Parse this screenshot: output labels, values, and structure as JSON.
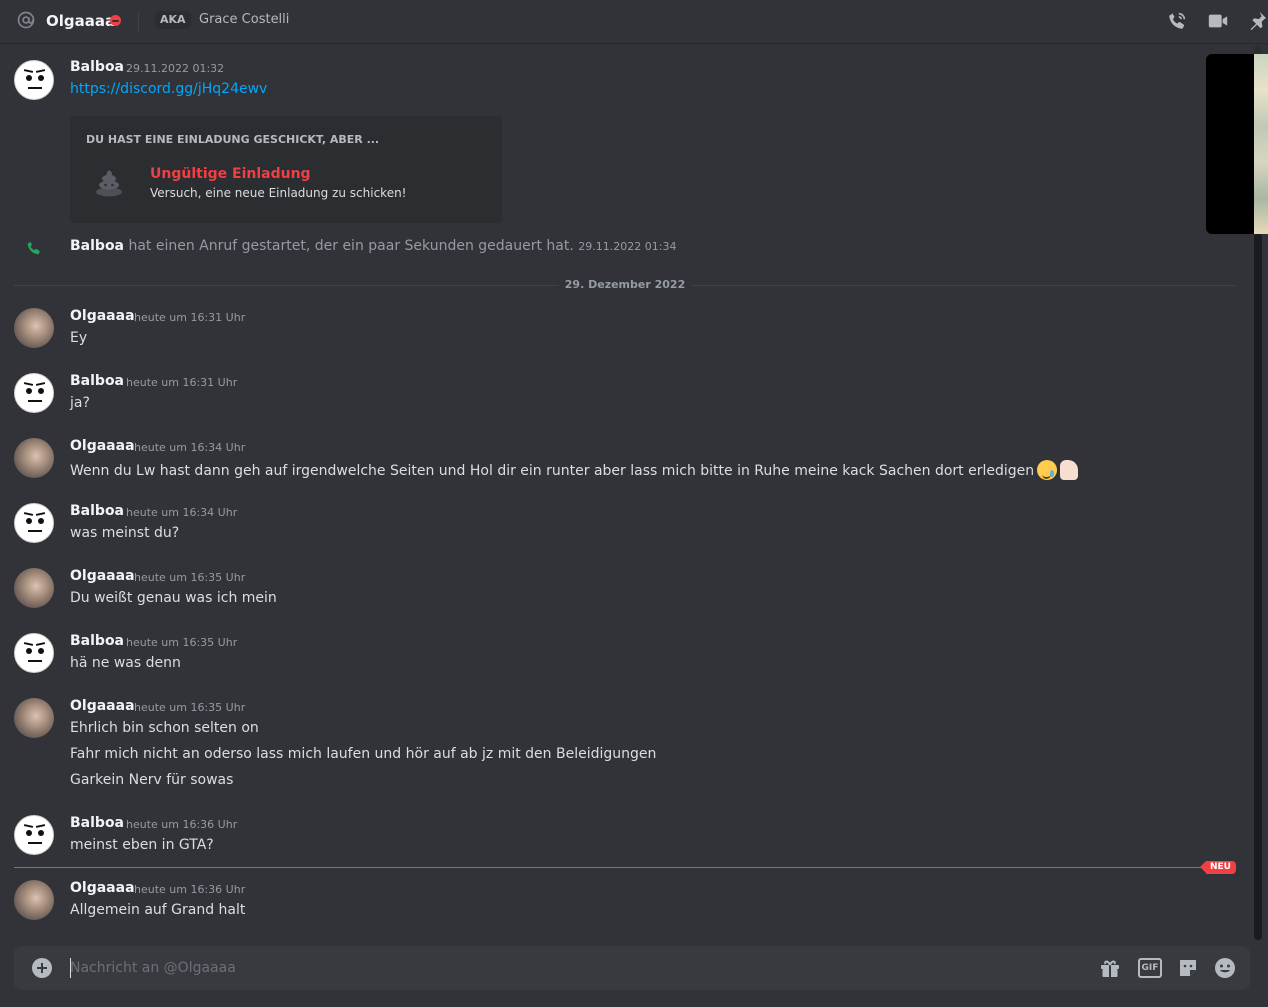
{
  "header": {
    "name": "Olgaaaa",
    "aka_label": "AKA",
    "aka_name": "Grace Costelli",
    "icons": [
      "at-icon",
      "dnd-status-icon",
      "voice-call-icon",
      "video-call-icon",
      "pin-icon"
    ]
  },
  "messages": {
    "m1": {
      "username": "Balboa",
      "timestamp": "29.11.2022 01:32",
      "link": "https://discord.gg/jHq24ewv",
      "embed": {
        "header": "DU HAST EINE EINLADUNG GESCHICKT, ABER ...",
        "title": "Ungültige Einladung",
        "subtitle": "Versuch, eine neue Einladung zu schicken!"
      }
    },
    "call": {
      "username": "Balboa",
      "text": "hat einen Anruf gestartet, der ein paar Sekunden gedauert hat.",
      "timestamp": "29.11.2022 01:34"
    },
    "date_divider": "29. Dezember 2022",
    "m2": {
      "username": "Olgaaaa",
      "timestamp": "heute um 16:31 Uhr",
      "text": "Ey"
    },
    "m3": {
      "username": "Balboa",
      "timestamp": "heute um 16:31 Uhr",
      "text": "ja?"
    },
    "m4": {
      "username": "Olgaaaa",
      "timestamp": "heute um 16:34 Uhr",
      "text": "Wenn du Lw hast dann geh auf irgendwelche Seiten und Hol dir ein runter aber lass mich bitte in Ruhe meine kack Sachen dort erledigen"
    },
    "m5": {
      "username": "Balboa",
      "timestamp": "heute um 16:34 Uhr",
      "text": "was meinst du?"
    },
    "m6": {
      "username": "Olgaaaa",
      "timestamp": "heute um 16:35 Uhr",
      "text": "Du weißt genau was ich mein"
    },
    "m7": {
      "username": "Balboa",
      "timestamp": "heute um 16:35 Uhr",
      "text": "hä ne was denn"
    },
    "m8": {
      "username": "Olgaaaa",
      "timestamp": "heute um 16:35 Uhr",
      "lines": [
        "Ehrlich bin schon selten on",
        "Fahr mich nicht an oderso lass mich laufen und hör auf ab jz mit den Beleidigungen",
        "Garkein Nerv für sowas"
      ]
    },
    "m9": {
      "username": "Balboa",
      "timestamp": "heute um 16:36 Uhr",
      "text": "meinst eben in GTA?"
    },
    "new_label": "NEU",
    "m10": {
      "username": "Olgaaaa",
      "timestamp": "heute um 16:36 Uhr",
      "text": "Allgemein auf Grand halt"
    }
  },
  "composer": {
    "placeholder": "Nachricht an @Olgaaaa",
    "gif_label": "GIF",
    "icons": [
      "add-attachment-icon",
      "gift-icon",
      "gif-icon",
      "sticker-icon",
      "emoji-icon"
    ]
  },
  "colors": {
    "background": "#313338",
    "composer": "#383a40",
    "embed": "#2b2d31",
    "link": "#00a8fc",
    "danger": "#f23f43",
    "call_green": "#23a55a"
  }
}
